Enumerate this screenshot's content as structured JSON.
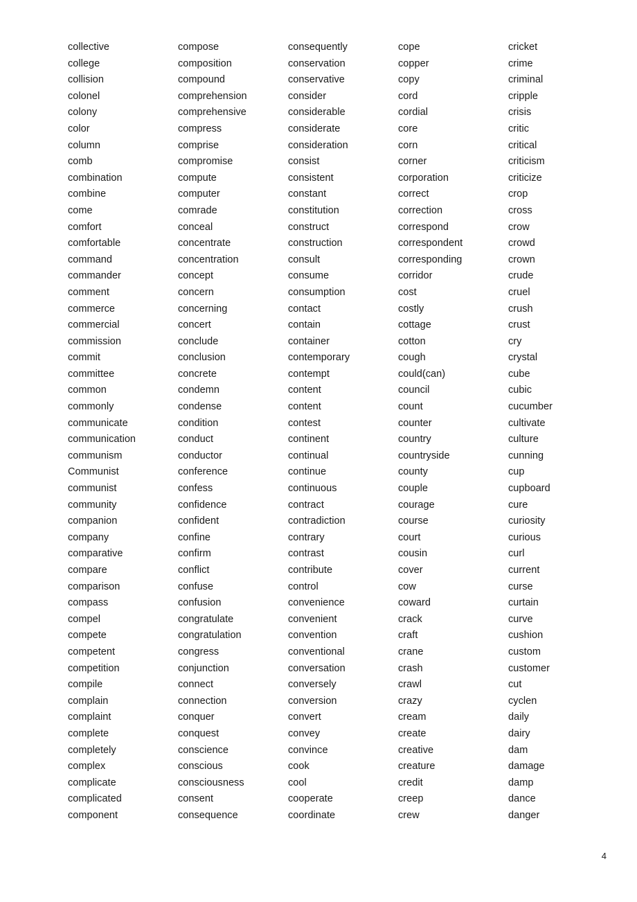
{
  "document": {
    "page_number": "4",
    "columns": [
      {
        "id": "column-1",
        "words": [
          "collective",
          "college",
          "collision",
          "colonel",
          "colony",
          "color",
          "column",
          "comb",
          "combination",
          "combine",
          "come",
          "comfort",
          "comfortable",
          "command",
          "commander",
          "comment",
          "commerce",
          "commercial",
          "commission",
          "commit",
          "committee",
          "common",
          "commonly",
          "communicate",
          "communication",
          "communism",
          "Communist",
          "communist",
          "community",
          "companion",
          "company",
          "comparative",
          "compare",
          "comparison",
          "compass",
          "compel",
          "compete",
          "competent",
          "competition",
          "compile",
          "complain",
          "complaint",
          "complete",
          "completely",
          "complex",
          "complicate",
          "complicated",
          "component"
        ]
      },
      {
        "id": "column-2",
        "words": [
          "compose",
          "composition",
          "compound",
          "comprehension",
          "comprehensive",
          "compress",
          "comprise",
          "compromise",
          "compute",
          "computer",
          "comrade",
          "conceal",
          "concentrate",
          "concentration",
          "concept",
          "concern",
          "concerning",
          "concert",
          "conclude",
          "conclusion",
          "concrete",
          "condemn",
          "condense",
          "condition",
          "conduct",
          "conductor",
          "conference",
          "confess",
          "confidence",
          "confident",
          "confine",
          "confirm",
          "conflict",
          "confuse",
          "confusion",
          "congratulate",
          "congratulation",
          "congress",
          "conjunction",
          "connect",
          "connection",
          "conquer",
          "conquest",
          "conscience",
          "conscious",
          "consciousness",
          "consent",
          "consequence"
        ]
      },
      {
        "id": "column-3",
        "words": [
          "consequently",
          "conservation",
          "conservative",
          "consider",
          "considerable",
          "considerate",
          "consideration",
          "consist",
          "consistent",
          "constant",
          "constitution",
          "construct",
          "construction",
          "consult",
          "consume",
          "consumption",
          "contact",
          "contain",
          "container",
          "contemporary",
          "contempt",
          "content",
          "content",
          "contest",
          "continent",
          "continual",
          "continue",
          "continuous",
          "contract",
          "contradiction",
          "contrary",
          "contrast",
          "contribute",
          "control",
          "convenience",
          "convenient",
          "convention",
          "conventional",
          "conversation",
          "conversely",
          "conversion",
          "convert",
          "convey",
          "convince",
          "cook",
          "cool",
          "cooperate",
          "coordinate"
        ]
      },
      {
        "id": "column-4",
        "words": [
          "cope",
          "copper",
          "copy",
          "cord",
          "cordial",
          "core",
          "corn",
          "corner",
          "corporation",
          "correct",
          "correction",
          "correspond",
          "correspondent",
          "corresponding",
          "corridor",
          "cost",
          "costly",
          "cottage",
          "cotton",
          "cough",
          "could(can)",
          "council",
          "count",
          "counter",
          "country",
          "countryside",
          "county",
          "couple",
          "courage",
          "course",
          "court",
          "cousin",
          "cover",
          "cow",
          "coward",
          "crack",
          "craft",
          "crane",
          "crash",
          "crawl",
          "crazy",
          "cream",
          "create",
          "creative",
          "creature",
          "credit",
          "creep",
          "crew"
        ]
      },
      {
        "id": "column-5",
        "words": [
          "cricket",
          "crime",
          "criminal",
          "cripple",
          "crisis",
          "critic",
          "critical",
          "criticism",
          "criticize",
          "crop",
          "cross",
          "crow",
          "crowd",
          "crown",
          "crude",
          "cruel",
          "crush",
          "crust",
          "cry",
          "crystal",
          "cube",
          "cubic",
          "cucumber",
          "cultivate",
          "culture",
          "cunning",
          "cup",
          "cupboard",
          "cure",
          "curiosity",
          "curious",
          "curl",
          "current",
          "curse",
          "curtain",
          "curve",
          "cushion",
          "custom",
          "customer",
          "cut",
          "cyclen",
          "daily",
          "dairy",
          "dam",
          "damage",
          "damp",
          "dance",
          "danger"
        ]
      }
    ]
  }
}
